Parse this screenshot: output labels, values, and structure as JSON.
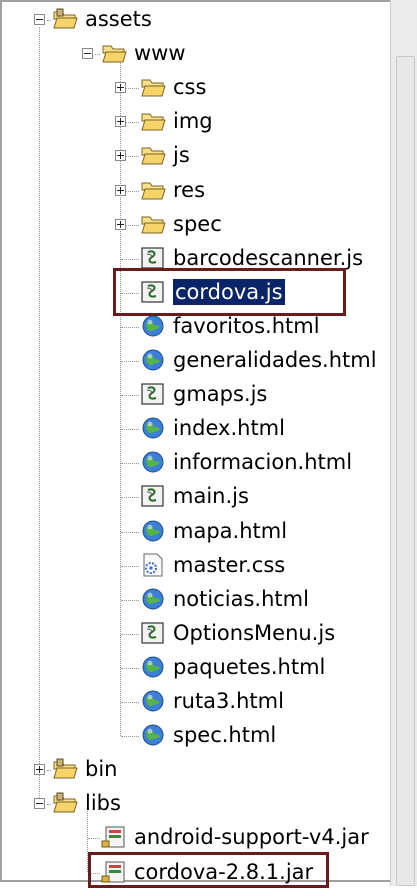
{
  "tree": [
    {
      "label": "assets",
      "icon": "package-folder-icon",
      "level": 0,
      "expandable": true,
      "expanded": true
    },
    {
      "label": "www",
      "icon": "folder-icon",
      "level": 1,
      "expandable": true,
      "expanded": true
    },
    {
      "label": "css",
      "icon": "folder-icon",
      "level": 2,
      "expandable": true,
      "expanded": false
    },
    {
      "label": "img",
      "icon": "folder-icon",
      "level": 2,
      "expandable": true,
      "expanded": false
    },
    {
      "label": "js",
      "icon": "folder-icon",
      "level": 2,
      "expandable": true,
      "expanded": false
    },
    {
      "label": "res",
      "icon": "folder-icon",
      "level": 2,
      "expandable": true,
      "expanded": false
    },
    {
      "label": "spec",
      "icon": "folder-icon",
      "level": 2,
      "expandable": true,
      "expanded": false
    },
    {
      "label": "barcodescanner.js",
      "icon": "script-file-icon",
      "level": 2
    },
    {
      "label": "cordova.js",
      "icon": "script-file-icon",
      "level": 2,
      "selected": true
    },
    {
      "label": "favoritos.html",
      "icon": "web-file-icon",
      "level": 2
    },
    {
      "label": "generalidades.html",
      "icon": "web-file-icon",
      "level": 2
    },
    {
      "label": "gmaps.js",
      "icon": "script-file-icon",
      "level": 2
    },
    {
      "label": "index.html",
      "icon": "web-file-icon",
      "level": 2
    },
    {
      "label": "informacion.html",
      "icon": "web-file-icon",
      "level": 2
    },
    {
      "label": "main.js",
      "icon": "script-file-icon",
      "level": 2
    },
    {
      "label": "mapa.html",
      "icon": "web-file-icon",
      "level": 2
    },
    {
      "label": "master.css",
      "icon": "css-file-icon",
      "level": 2
    },
    {
      "label": "noticias.html",
      "icon": "web-file-icon",
      "level": 2
    },
    {
      "label": "OptionsMenu.js",
      "icon": "script-file-icon",
      "level": 2
    },
    {
      "label": "paquetes.html",
      "icon": "web-file-icon",
      "level": 2
    },
    {
      "label": "ruta3.html",
      "icon": "web-file-icon",
      "level": 2
    },
    {
      "label": "spec.html",
      "icon": "web-file-icon",
      "level": 2
    },
    {
      "label": "bin",
      "icon": "package-folder-icon",
      "level": 0,
      "expandable": true,
      "expanded": false
    },
    {
      "label": "libs",
      "icon": "package-folder-icon",
      "level": 0,
      "expandable": true,
      "expanded": true
    },
    {
      "label": "android-support-v4.jar",
      "icon": "jar-file-icon",
      "level": 1
    },
    {
      "label": "cordova-2.8.1.jar",
      "icon": "jar-file-icon",
      "level": 1
    }
  ],
  "colors": {
    "selection": "#0a246a",
    "highlight_box": "#6b1b1b",
    "folder": "#f3d36a"
  }
}
